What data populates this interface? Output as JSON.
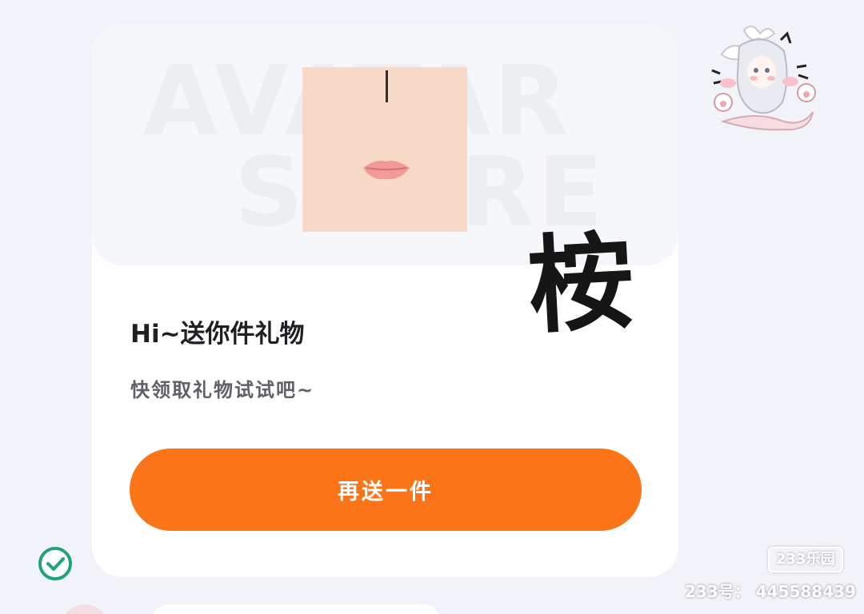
{
  "gift": {
    "title": "Hi~送你件礼物",
    "subtitle": "快领取礼物试试吧~",
    "send_again_label": "再送一件",
    "watermark_line1": "AVATAR",
    "watermark_line2": "STORE"
  },
  "decoration": {
    "brush_character": "桉"
  },
  "brand": {
    "badge_text": "233乐园",
    "account_id": "233号： 445588439"
  },
  "colors": {
    "accent": "#fb7417",
    "background": "#f2f3f8",
    "check": "#1fa37a"
  },
  "icons": {
    "check": "check-circle-icon",
    "sticker": "anime-girl-sticker"
  }
}
